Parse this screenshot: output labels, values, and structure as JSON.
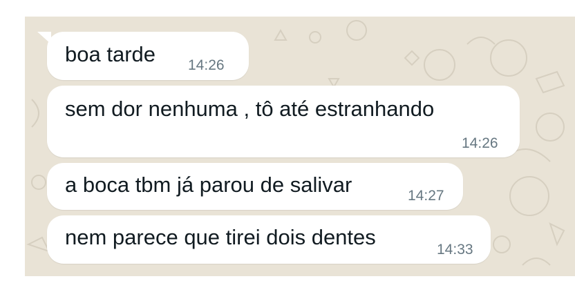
{
  "messages": [
    {
      "text": "boa tarde",
      "time": "14:26"
    },
    {
      "text": "sem dor nenhuma , tô até estranhando",
      "time": "14:26"
    },
    {
      "text": "a boca tbm já parou de salivar",
      "time": "14:27"
    },
    {
      "text": "nem parece que tirei dois dentes",
      "time": "14:33"
    }
  ],
  "colors": {
    "wallpaper": "#e9e3d6",
    "bubble": "#ffffff",
    "timestamp": "#667781",
    "text": "#111b21"
  }
}
